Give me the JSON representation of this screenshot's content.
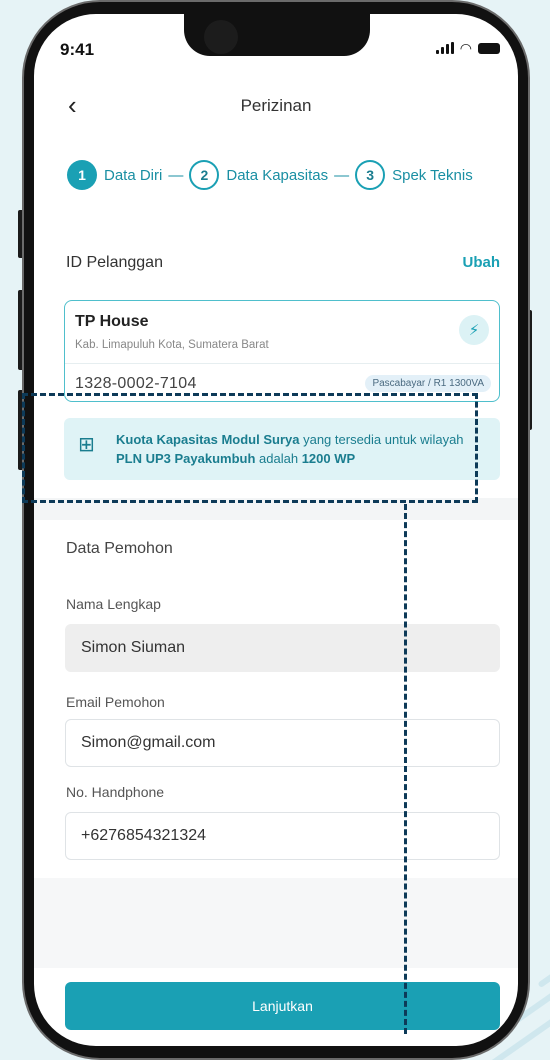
{
  "status_bar": {
    "time": "9:41"
  },
  "header": {
    "back_icon": "chevron-left-icon",
    "title": "Perizinan"
  },
  "stepper": {
    "steps": [
      {
        "number": "1",
        "label": "Data Diri",
        "active": true
      },
      {
        "number": "2",
        "label": "Data Kapasitas",
        "active": false
      },
      {
        "number": "3",
        "label": "Spek Teknis",
        "active": false
      }
    ],
    "separator": "—"
  },
  "customer_section": {
    "heading": "ID Pelanggan",
    "edit_label": "Ubah"
  },
  "customer_card": {
    "name": "TP House",
    "location": "Kab. Limapuluh Kota, Sumatera Barat",
    "customer_id": "1328-0002-7104",
    "tariff_badge": "Pascabayar / R1 1300VA",
    "logo_icon": "pln-logo-icon"
  },
  "quota_info": {
    "icon": "solar-panel-icon",
    "part1": "Kuota Kapasitas Modul Surya",
    "part2": " yang tersedia untuk wilayah ",
    "part3": "PLN UP3 Payakumbuh",
    "part4": " adalah ",
    "part5": "1200 WP"
  },
  "applicant": {
    "title": "Data Pemohon",
    "full_name_label": "Nama Lengkap",
    "full_name_value": "Simon Siuman",
    "email_label": "Email Pemohon",
    "email_value": "Simon@gmail.com",
    "phone_label": "No. Handphone",
    "phone_value": "+6276854321324"
  },
  "footer": {
    "submit_label": "Lanjutkan"
  },
  "colors": {
    "accent": "#1aa0b4",
    "info_bg": "#dff3f6",
    "annotation": "#0d3a58"
  }
}
